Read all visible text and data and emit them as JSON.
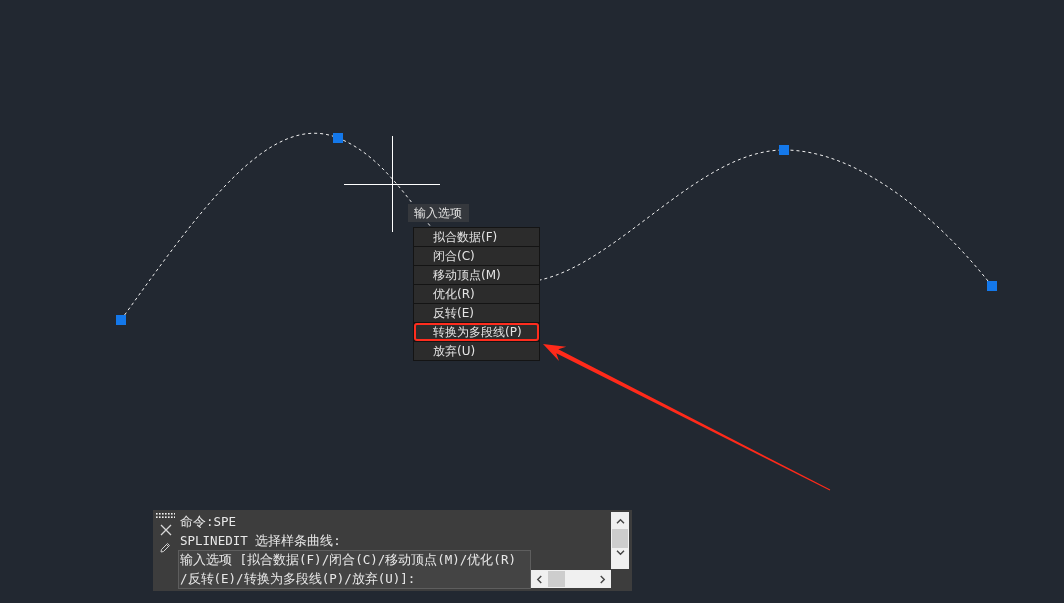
{
  "canvas": {
    "cursor_tooltip": "输入选项",
    "option_menu": {
      "items": [
        {
          "label": "拟合数据(F)",
          "annotated": false
        },
        {
          "label": "闭合(C)",
          "annotated": false
        },
        {
          "label": "移动顶点(M)",
          "annotated": false
        },
        {
          "label": "优化(R)",
          "annotated": false
        },
        {
          "label": "反转(E)",
          "annotated": false
        },
        {
          "label": "转换为多段线(P)",
          "annotated": true
        },
        {
          "label": "放弃(U)",
          "annotated": false
        }
      ]
    }
  },
  "command_line": {
    "history": [
      "命令:SPE",
      "SPLINEDIT 选择样条曲线:"
    ],
    "prompt_lines": [
      "输入选项 [拟合数据(F)/闭合(C)/移动顶点(M)/优化(R)",
      "/反转(E)/转换为多段线(P)/放弃(U)]:"
    ]
  }
}
